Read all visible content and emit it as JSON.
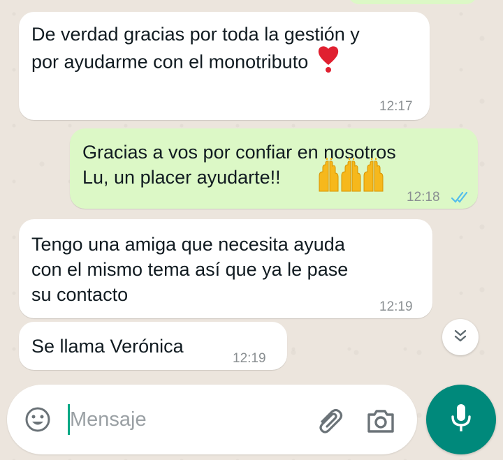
{
  "messages": [
    {
      "direction": "in",
      "text": "De verdad gracias por toda la gestión y\npor ayudarme con el monotributo",
      "emoji": "red-heart-exclamation",
      "time": "12:17"
    },
    {
      "direction": "out",
      "text_line1": "Gracias a vos por confiar en nosotros",
      "text_line2": "Lu, un placer ayudarte!!",
      "emoji": "raising-hands",
      "time": "12:18",
      "status": "read"
    },
    {
      "direction": "in",
      "text": "Tengo una amiga que necesita ayuda\ncon el mismo tema así que ya le pase\nsu contacto",
      "time": "12:19"
    },
    {
      "direction": "in",
      "text": "Se llama Verónica",
      "time": "12:19"
    }
  ],
  "composer": {
    "placeholder": "Mensaje",
    "value": ""
  },
  "icons": {
    "emoji": "emoji-smiley-icon",
    "attach": "paperclip-icon",
    "camera": "camera-icon",
    "mic": "microphone-icon",
    "scroll": "double-chevron-down-icon",
    "read_ticks": "double-check-icon"
  },
  "colors": {
    "outgoing_bubble": "#dcf8c6",
    "incoming_bubble": "#ffffff",
    "accent": "#00897b",
    "read_ticks": "#53bdeb",
    "background": "#ece5dd"
  }
}
